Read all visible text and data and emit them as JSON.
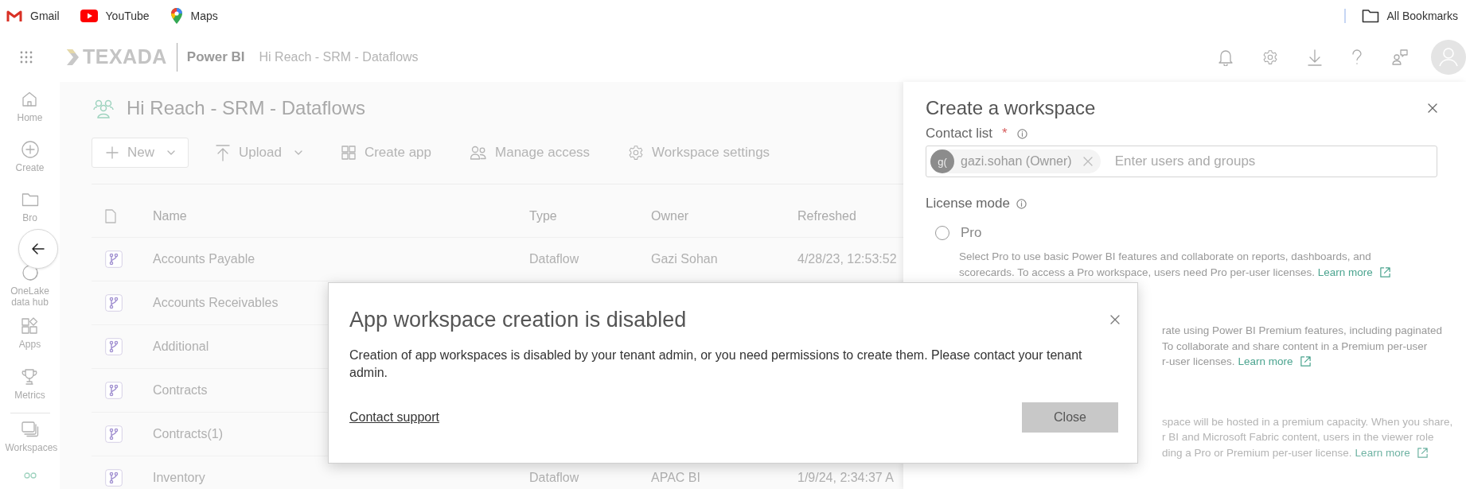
{
  "bookmarks": [
    {
      "label": "Gmail",
      "kind": "gmail"
    },
    {
      "label": "YouTube",
      "kind": "youtube"
    },
    {
      "label": "Maps",
      "kind": "maps"
    }
  ],
  "all_bookmarks": "All Bookmarks",
  "app_bar": {
    "brand": "TEXADA",
    "product": "Power BI",
    "breadcrumb": "Hi Reach - SRM - Dataflows"
  },
  "sidebar": {
    "items": [
      {
        "label": "Home",
        "kind": "home"
      },
      {
        "label": "Create",
        "kind": "create"
      },
      {
        "label": "Bro",
        "kind": "browse"
      },
      {
        "label": "OneLake data hub",
        "kind": "onelake"
      },
      {
        "label": "Apps",
        "kind": "apps"
      },
      {
        "label": "Metrics",
        "kind": "metrics"
      },
      {
        "label": "Workspaces",
        "kind": "workspaces"
      }
    ]
  },
  "workspace": {
    "title": "Hi Reach - SRM - Dataflows"
  },
  "toolbar": [
    {
      "label": "New",
      "kind": "new",
      "dropdown": true
    },
    {
      "label": "Upload",
      "kind": "upload",
      "dropdown": true
    },
    {
      "label": "Create app",
      "kind": "app",
      "dropdown": false
    },
    {
      "label": "Manage access",
      "kind": "access",
      "dropdown": false
    },
    {
      "label": "Workspace settings",
      "kind": "settings",
      "dropdown": false
    }
  ],
  "table": {
    "columns": [
      "Name",
      "Type",
      "Owner",
      "Refreshed"
    ],
    "rows": [
      {
        "name": "Accounts Payable",
        "type": "Dataflow",
        "owner": "Gazi Sohan",
        "refreshed": "4/28/23, 12:53:52"
      },
      {
        "name": "Accounts Receivables"
      },
      {
        "name": "Additional"
      },
      {
        "name": "Contracts"
      },
      {
        "name": "Contracts(1)"
      },
      {
        "name": "Inventory",
        "type": "Dataflow",
        "owner": "APAC BI",
        "refreshed": "1/9/24, 2:34:37 A"
      }
    ]
  },
  "panel": {
    "title": "Create a workspace",
    "contact_label": "Contact list",
    "required_mark": "*",
    "chip": {
      "initials": "g(",
      "label": "gazi.sohan (Owner)"
    },
    "placeholder": "Enter users and groups",
    "license_label": "License mode",
    "options": [
      {
        "label": "Pro",
        "selected": false,
        "description": "Select Pro to use basic Power BI features and collaborate on reports, dashboards, and scorecards. To access a Pro workspace, users need Pro per-user licenses.",
        "link": "Learn more"
      }
    ],
    "covered_sections": [
      {
        "lines": [
          "rate using Power BI Premium features, including paginated",
          "To collaborate and share content in a Premium per-user",
          "r-user licenses."
        ],
        "link": "Learn more",
        "disabled": false
      },
      {
        "lines": [
          "space will be hosted in a premium capacity. When you share,",
          "r BI and Microsoft Fabric content, users in the viewer role",
          "ding a Pro or Premium per-user license."
        ],
        "link": "Learn more",
        "disabled": true
      }
    ]
  },
  "dialog": {
    "title": "App workspace creation is disabled",
    "message": "Creation of app workspaces is disabled by your tenant admin, or you need permissions to create them. Please contact your tenant admin.",
    "link": "Contact support",
    "button": "Close"
  }
}
